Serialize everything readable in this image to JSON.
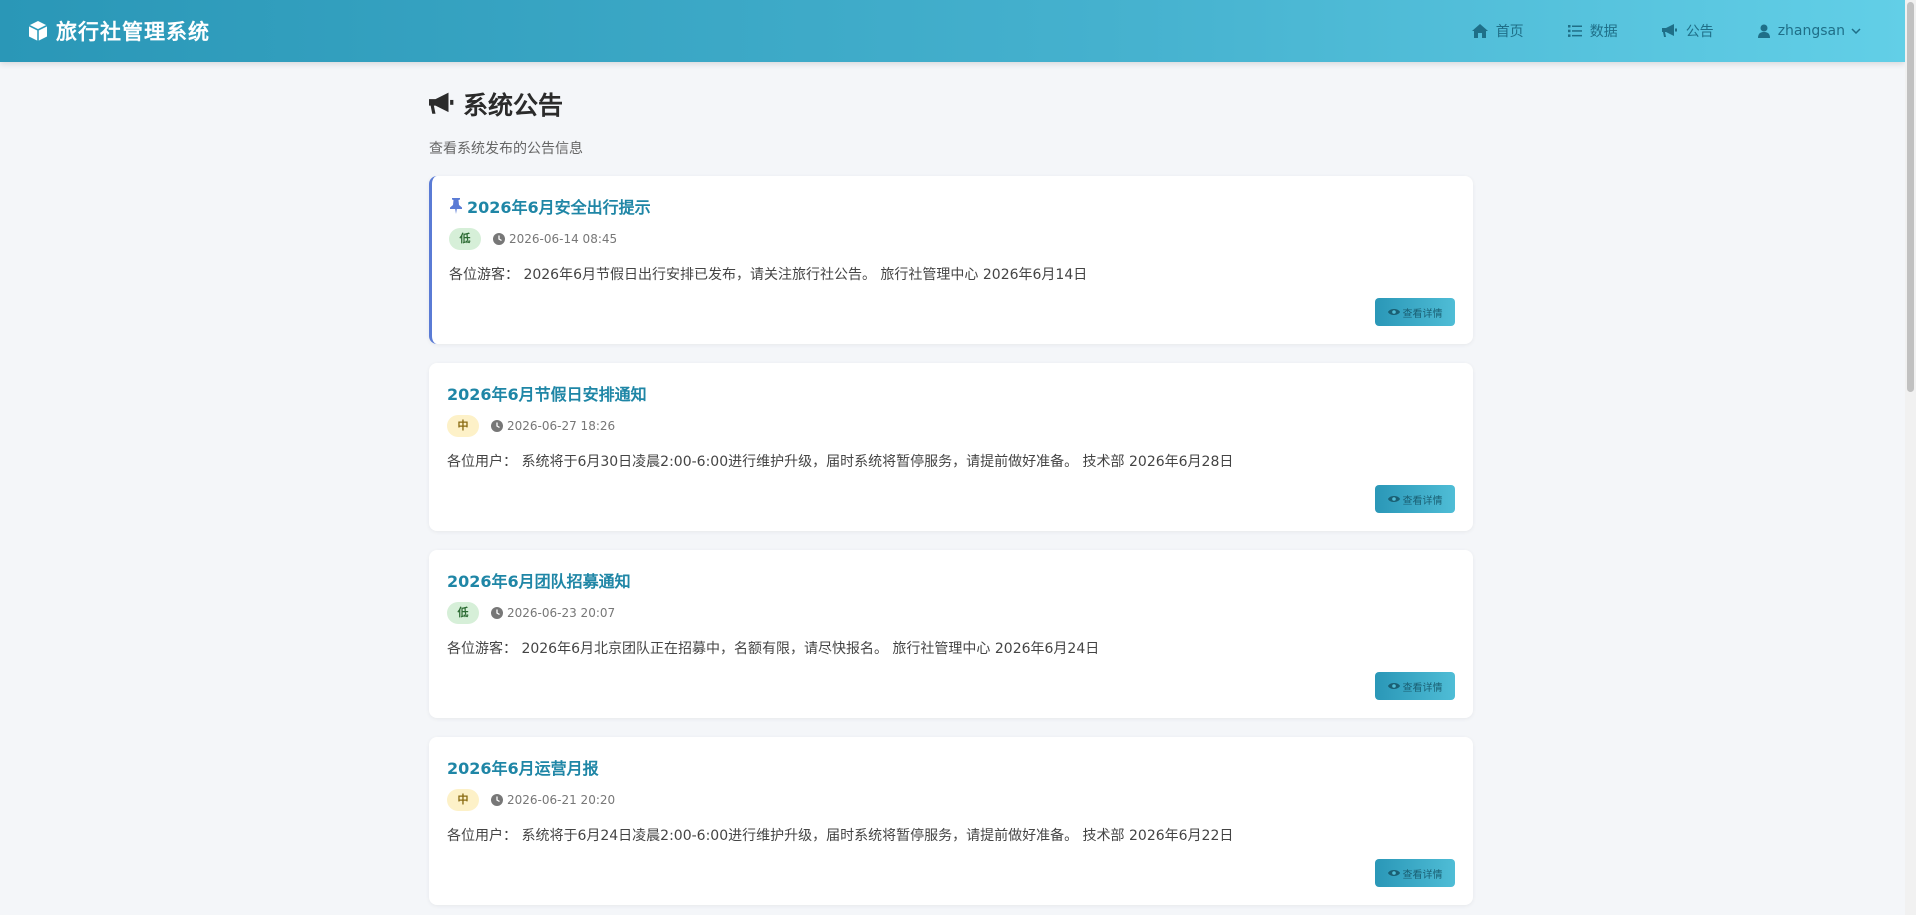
{
  "app": {
    "title": "旅行社管理系统"
  },
  "nav": {
    "home": "首页",
    "data": "数据",
    "notice": "公告",
    "user": "zhangsan"
  },
  "page": {
    "title": "系统公告",
    "subtitle": "查看系统发布的公告信息"
  },
  "notices": [
    {
      "title": "2026年6月安全出行提示",
      "pinned": true,
      "priority": "低",
      "time": "2026-06-14 08:45",
      "content": "各位游客： 2026年6月节假日出行安排已发布，请关注旅行社公告。 旅行社管理中心 2026年6月14日",
      "button": "查看详情"
    },
    {
      "title": "2026年6月节假日安排通知",
      "pinned": false,
      "priority": "中",
      "time": "2026-06-27 18:26",
      "content": "各位用户： 系统将于6月30日凌晨2:00-6:00进行维护升级，届时系统将暂停服务，请提前做好准备。 技术部 2026年6月28日",
      "button": "查看详情"
    },
    {
      "title": "2026年6月团队招募通知",
      "pinned": false,
      "priority": "低",
      "time": "2026-06-23 20:07",
      "content": "各位游客： 2026年6月北京团队正在招募中，名额有限，请尽快报名。 旅行社管理中心 2026年6月24日",
      "button": "查看详情"
    },
    {
      "title": "2026年6月运营月报",
      "pinned": false,
      "priority": "中",
      "time": "2026-06-21 20:20",
      "content": "各位用户： 系统将于6月24日凌晨2:00-6:00进行维护升级，届时系统将暂停服务，请提前做好准备。 技术部 2026年6月22日",
      "button": "查看详情"
    }
  ]
}
